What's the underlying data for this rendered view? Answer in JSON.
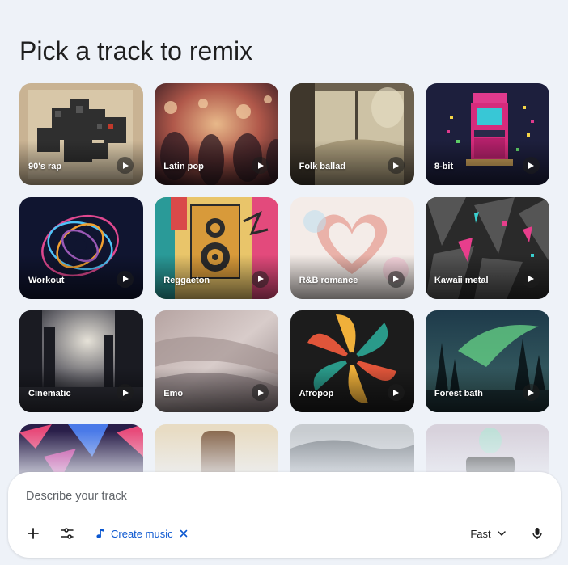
{
  "page": {
    "title": "Pick a track to remix"
  },
  "tracks": [
    {
      "label": "90's rap"
    },
    {
      "label": "Latin pop"
    },
    {
      "label": "Folk ballad"
    },
    {
      "label": "8-bit"
    },
    {
      "label": "Workout"
    },
    {
      "label": "Reggaeton"
    },
    {
      "label": "R&B romance"
    },
    {
      "label": "Kawaii metal"
    },
    {
      "label": "Cinematic"
    },
    {
      "label": "Emo"
    },
    {
      "label": "Afropop"
    },
    {
      "label": "Forest bath"
    }
  ],
  "composer": {
    "placeholder": "Describe your track",
    "add_icon": "plus-icon",
    "tools_icon": "tune-icon",
    "chip_icon": "music-note-icon",
    "chip_label": "Create music",
    "chip_close_icon": "close-icon",
    "mode_label": "Fast",
    "mode_icon": "chevron-down-icon",
    "mic_icon": "mic-icon"
  },
  "colors": {
    "background": "#eef2f8",
    "accent": "#0b57d0",
    "text": "#1f1f1f",
    "muted": "#5f6368"
  }
}
